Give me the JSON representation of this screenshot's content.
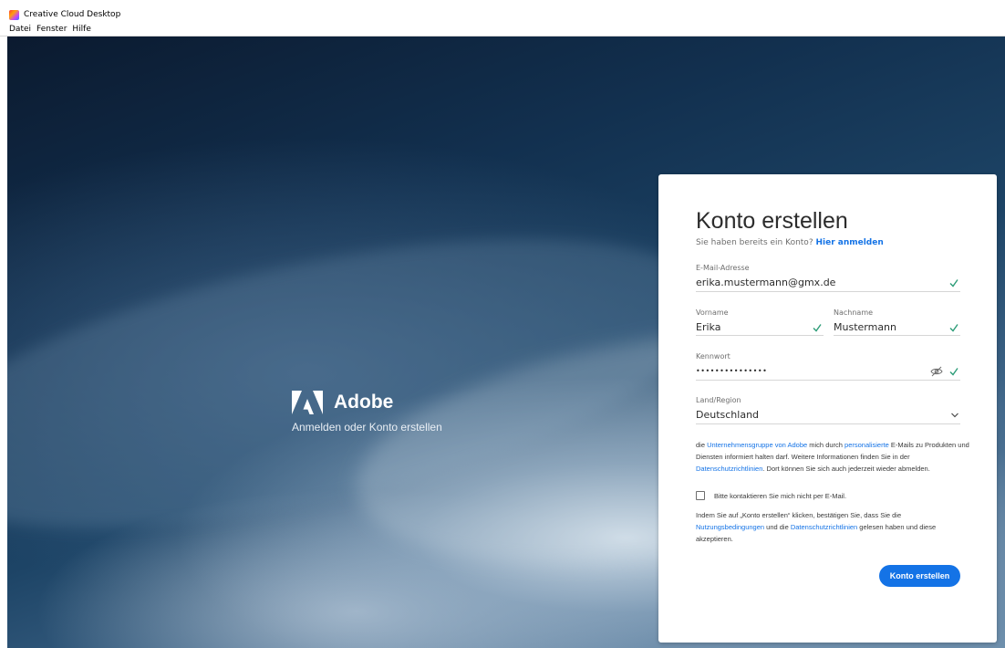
{
  "window": {
    "title": "Creative Cloud Desktop",
    "menu": [
      "Datei",
      "Fenster",
      "Hilfe"
    ]
  },
  "brand": {
    "logo_icon": "adobe-logo-icon",
    "name": "Adobe",
    "tagline": "Anmelden oder Konto erstellen"
  },
  "form": {
    "title": "Konto erstellen",
    "subtitle_prefix": "Sie haben bereits ein Konto?",
    "signin_link": "Hier anmelden",
    "email": {
      "label": "E-Mail-Adresse",
      "value": "erika.mustermann@gmx.de"
    },
    "firstname": {
      "label": "Vorname",
      "value": "Erika"
    },
    "lastname": {
      "label": "Nachname",
      "value": "Mustermann"
    },
    "password": {
      "label": "Kennwort",
      "value": "•••••••••••••••"
    },
    "country": {
      "label": "Land/Region",
      "value": "Deutschland"
    },
    "legal1": {
      "t1": "die ",
      "link1": "Unternehmensgruppe von Adobe",
      "t2": " mich durch ",
      "link2": "personalisierte",
      "t3": " E-Mails zu Produkten und Diensten informiert halten darf. Weitere Informationen finden Sie in der ",
      "link3": "Datenschutzrichtlinien",
      "t4": ". Dort können Sie sich auch jederzeit wieder abmelden."
    },
    "optout_label": "Bitte kontaktieren Sie mich nicht per E-Mail.",
    "legal2": {
      "t1": "Indem Sie auf „Konto erstellen“ klicken, bestätigen Sie, dass Sie die ",
      "link1": "Nutzungsbedingungen",
      "t2": " und die ",
      "link2": "Datenschutzrichtlinien",
      "t3": " gelesen haben und diese akzeptieren."
    },
    "submit_label": "Konto erstellen"
  },
  "colors": {
    "accent": "#1473e6",
    "valid_check": "#2d9d78"
  }
}
